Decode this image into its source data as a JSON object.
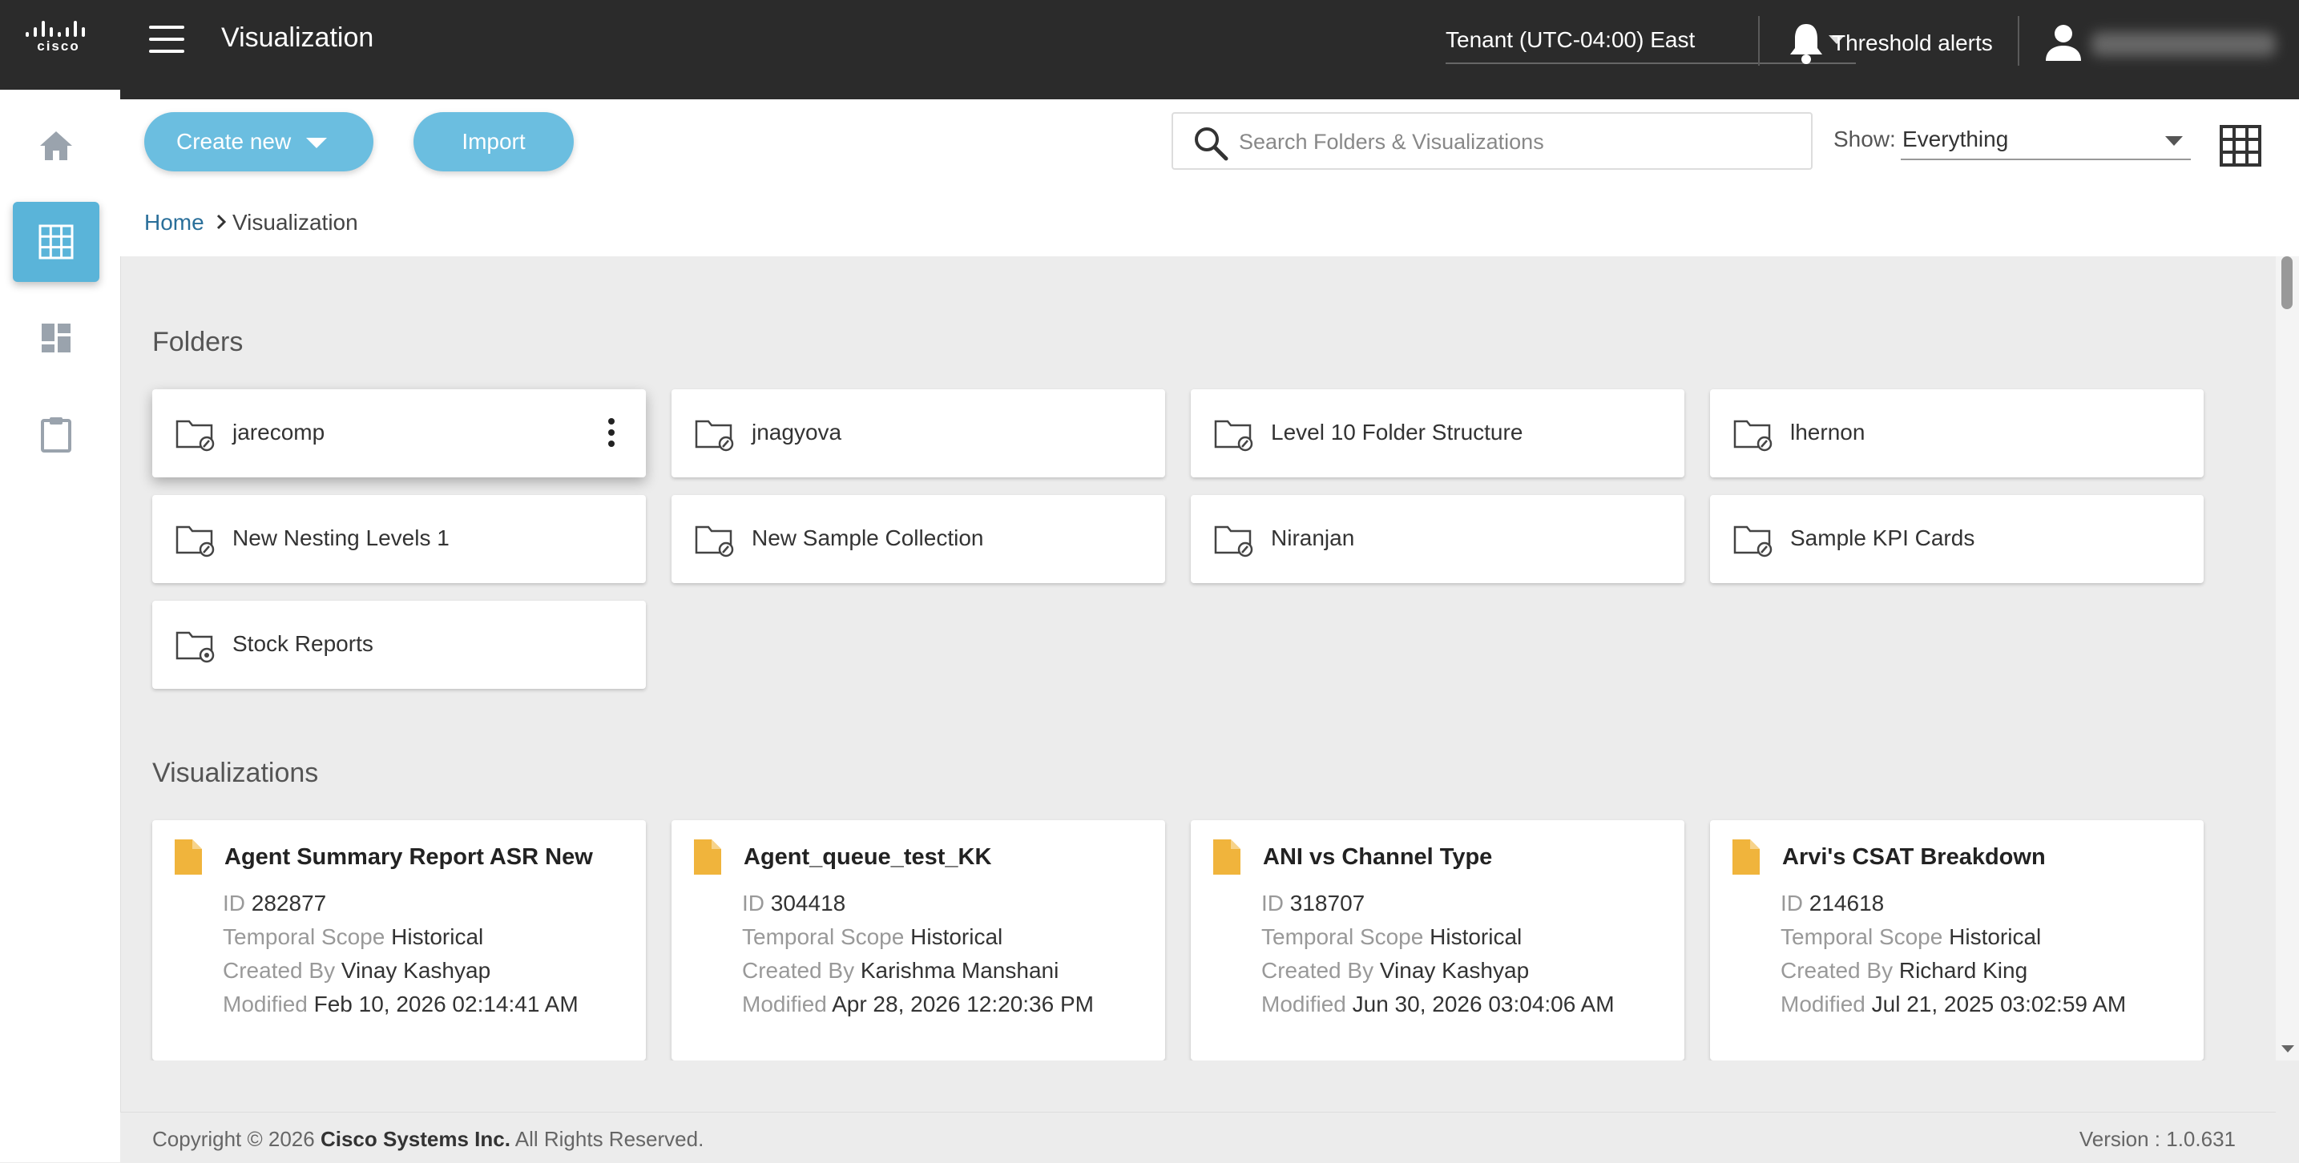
{
  "header": {
    "brand": "cisco",
    "title": "Visualization",
    "tenant": "Tenant (UTC-04:00) East",
    "alerts_label": "Threshold alerts"
  },
  "toolbar": {
    "create_label": "Create new",
    "import_label": "Import",
    "search_placeholder": "Search Folders & Visualizations",
    "show_label": "Show:",
    "show_value": "Everything"
  },
  "breadcrumb": {
    "home": "Home",
    "current": "Visualization"
  },
  "folders": {
    "title": "Folders",
    "items": [
      {
        "name": "jarecomp"
      },
      {
        "name": "jnagyova"
      },
      {
        "name": "Level 10 Folder Structure"
      },
      {
        "name": "lhernon"
      },
      {
        "name": "New Nesting Levels 1"
      },
      {
        "name": "New Sample Collection"
      },
      {
        "name": "Niranjan"
      },
      {
        "name": "Sample KPI Cards"
      },
      {
        "name": "Stock Reports"
      }
    ]
  },
  "visualizations": {
    "title": "Visualizations",
    "labels": {
      "id": "ID",
      "scope": "Temporal Scope",
      "created": "Created By",
      "modified": "Modified"
    },
    "items": [
      {
        "name": "Agent Summary Report ASR New",
        "id": "282877",
        "scope": "Historical",
        "created_by": "Vinay Kashyap",
        "modified": "Feb 10, 2026 02:14:41 AM"
      },
      {
        "name": "Agent_queue_test_KK",
        "id": "304418",
        "scope": "Historical",
        "created_by": "Karishma Manshani",
        "modified": "Apr 28, 2026 12:20:36 PM"
      },
      {
        "name": "ANI vs Channel Type",
        "id": "318707",
        "scope": "Historical",
        "created_by": "Vinay Kashyap",
        "modified": "Jun 30, 2026 03:04:06 AM"
      },
      {
        "name": "Arvi's CSAT Breakdown",
        "id": "214618",
        "scope": "Historical",
        "created_by": "Richard King",
        "modified": "Jul 21, 2025 03:02:59 AM"
      }
    ]
  },
  "footer": {
    "copyright_prefix": "Copyright © 2026",
    "company": "Cisco Systems Inc.",
    "rights": "All Rights Reserved.",
    "version": "Version : 1.0.631"
  },
  "colors": {
    "accent": "#5ab4d9",
    "topbar": "#2b2b2b",
    "doc_icon": "#f0b43c",
    "link": "#2a6f9a"
  }
}
